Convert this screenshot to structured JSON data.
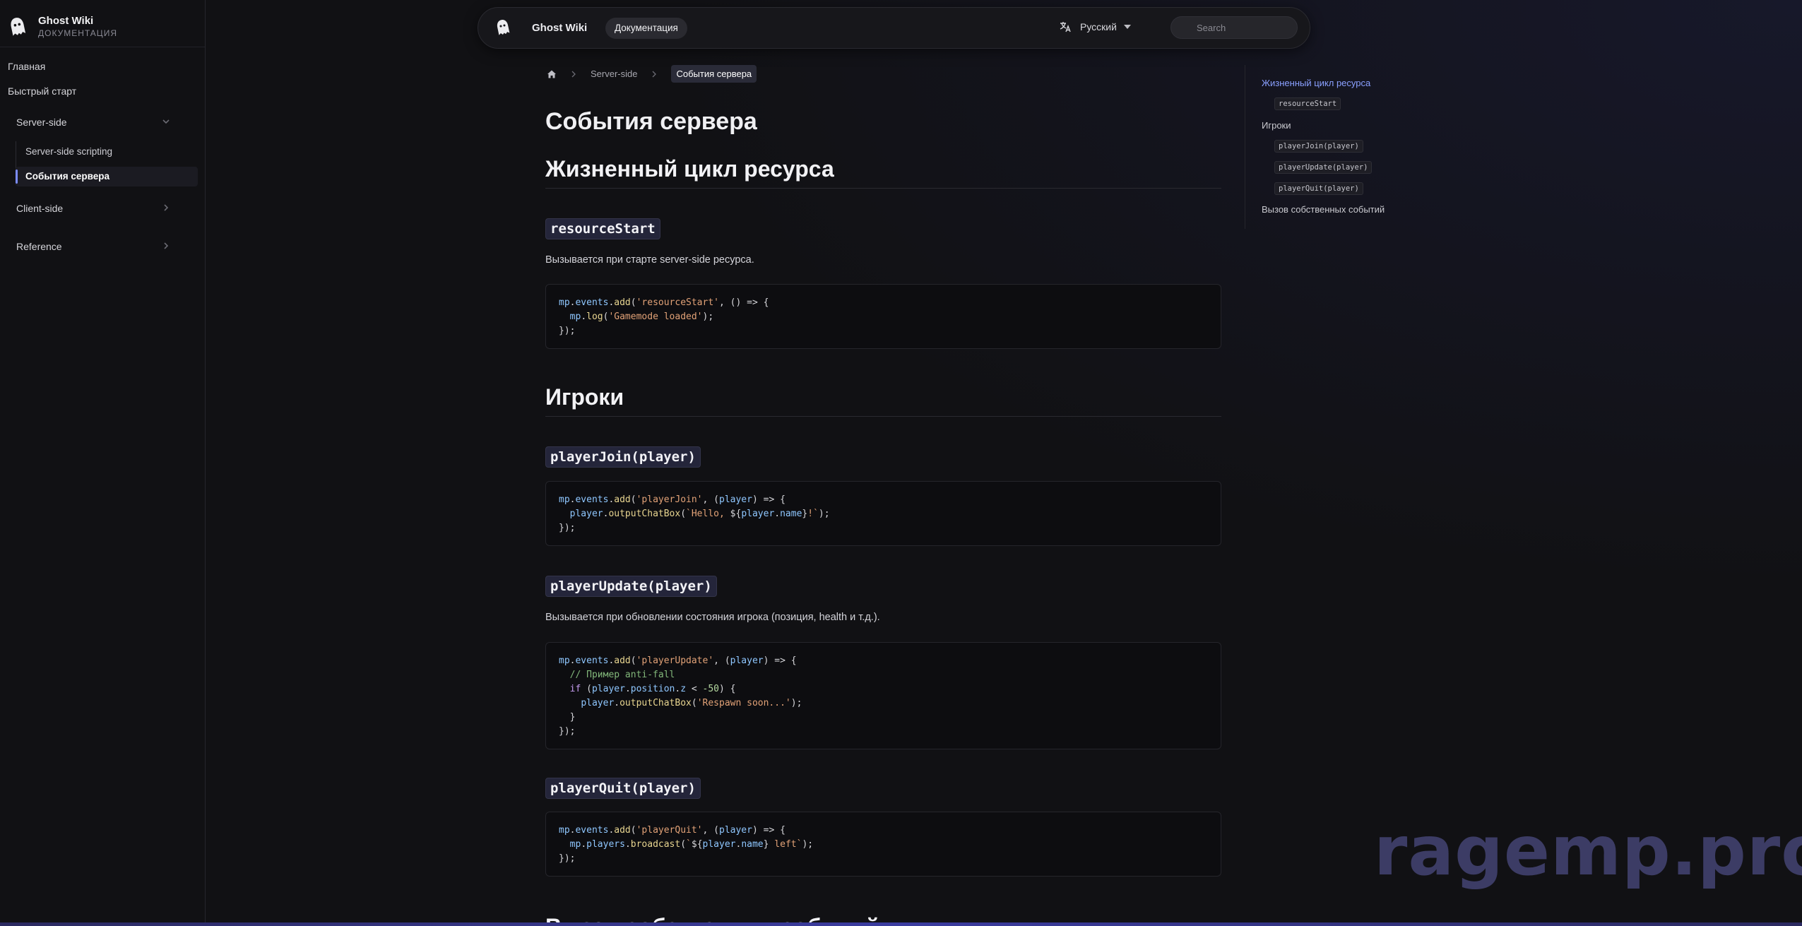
{
  "brand": {
    "title": "Ghost Wiki",
    "subtitle": "ДОКУМЕНТАЦИЯ"
  },
  "sidebar": {
    "home": "Главная",
    "quickstart": "Быстрый старт",
    "server_side": {
      "label": "Server-side",
      "items": [
        "Server-side scripting",
        "События сервера"
      ],
      "active": "События сервера"
    },
    "client_side": "Client-side",
    "reference": "Reference"
  },
  "topbar": {
    "title": "Ghost Wiki",
    "tab": "Документация",
    "language": "Русский",
    "search_placeholder": "Search"
  },
  "breadcrumb": {
    "section": "Server-side",
    "current": "События сервера"
  },
  "content": {
    "page_title": "События сервера",
    "sections": {
      "lifecycle": {
        "heading": "Жизненный цикл ресурса",
        "resourceStart": {
          "title": "resourceStart",
          "description": "Вызывается при старте server-side ресурса."
        }
      },
      "players": {
        "heading": "Игроки",
        "playerJoin": {
          "title": "playerJoin(player)"
        },
        "playerUpdate": {
          "title": "playerUpdate(player)",
          "description": "Вызывается при обновлении состояния игрока (позиция, health и т.д.)."
        },
        "playerQuit": {
          "title": "playerQuit(player)"
        }
      },
      "next_heading_partial": "Вызов собственных событий"
    }
  },
  "toc": {
    "items": [
      {
        "label": "Жизненный цикл ресурса",
        "active": true
      },
      {
        "label": "resourceStart",
        "code": true
      },
      {
        "label": "Игроки"
      },
      {
        "label": "playerJoin(player)",
        "code": true
      },
      {
        "label": "playerUpdate(player)",
        "code": true
      },
      {
        "label": "playerQuit(player)",
        "code": true
      },
      {
        "label": "Вызов собственных событий"
      }
    ]
  },
  "watermark": "ragemp.pro",
  "colors": {
    "accent": "#7b8cff",
    "background": "#111114",
    "code_bg": "#0d0d10"
  },
  "icons": {
    "logo": "ghost-icon",
    "home": "home-icon",
    "language": "translate-icon",
    "search": "search-icon",
    "chevron": "chevron-icon"
  }
}
